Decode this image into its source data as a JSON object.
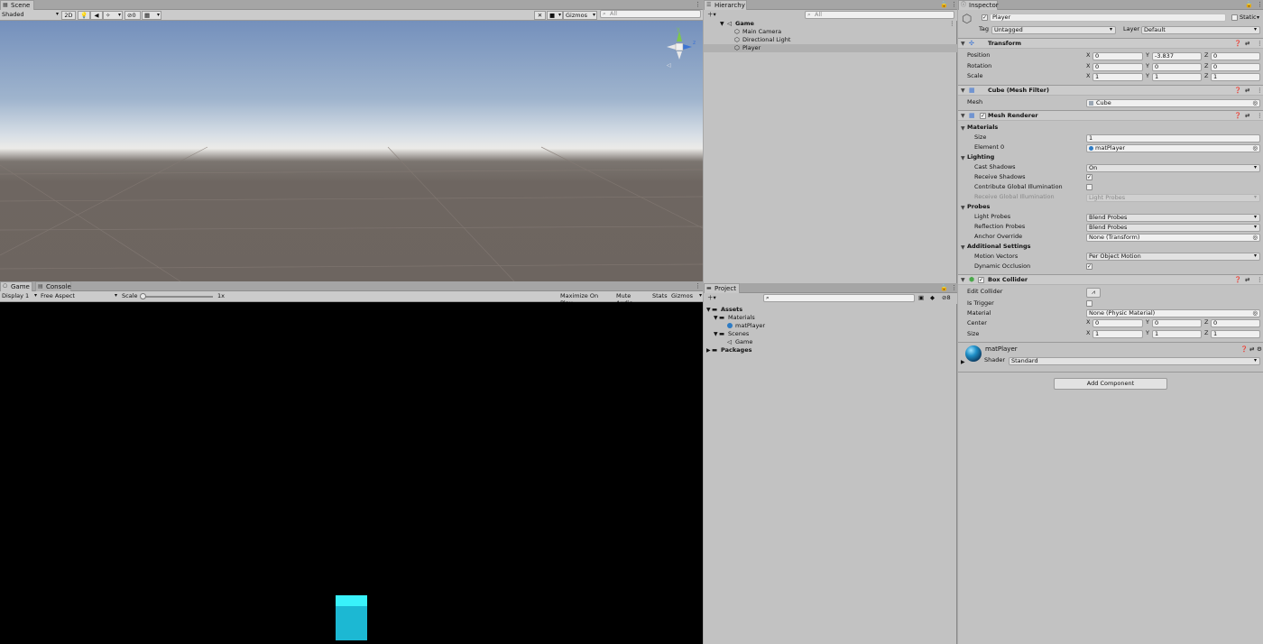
{
  "scene": {
    "tab": "Scene",
    "shading": "Shaded",
    "btn_2d": "2D",
    "hidden_count": "0",
    "gizmos": "Gizmos",
    "search_placeholder": "All"
  },
  "game": {
    "tab_game": "Game",
    "tab_console": "Console",
    "display": "Display 1",
    "aspect": "Free Aspect",
    "scale_label": "Scale",
    "scale_value": "1x",
    "maximize": "Maximize On Play",
    "mute": "Mute Audio",
    "stats": "Stats",
    "gizmos": "Gizmos",
    "cube_color": "#1cb8d3"
  },
  "hierarchy": {
    "tab": "Hierarchy",
    "search_placeholder": "All",
    "scene_name": "Game",
    "items": [
      "Main Camera",
      "Directional Light",
      "Player"
    ]
  },
  "project": {
    "tab": "Project",
    "hidden_count": "8",
    "assets": "Assets",
    "materials": "Materials",
    "matPlayer": "matPlayer",
    "scenes": "Scenes",
    "scene_game": "Game",
    "packages": "Packages"
  },
  "inspector": {
    "tab": "Inspector",
    "object_name": "Player",
    "static_label": "Static",
    "tag_label": "Tag",
    "tag_value": "Untagged",
    "layer_label": "Layer",
    "layer_value": "Default",
    "transform": {
      "title": "Transform",
      "position_label": "Position",
      "rotation_label": "Rotation",
      "scale_label": "Scale",
      "position": [
        "0",
        "-3.837",
        "0"
      ],
      "rotation": [
        "0",
        "0",
        "0"
      ],
      "scale": [
        "1",
        "1",
        "1"
      ]
    },
    "mesh_filter": {
      "title": "Cube (Mesh Filter)",
      "mesh_label": "Mesh",
      "mesh_value": "Cube"
    },
    "mesh_renderer": {
      "title": "Mesh Renderer",
      "materials": "Materials",
      "size_label": "Size",
      "size_value": "1",
      "element0_label": "Element 0",
      "element0_value": "matPlayer",
      "lighting": "Lighting",
      "cast_shadows_label": "Cast Shadows",
      "cast_shadows_value": "On",
      "receive_shadows_label": "Receive Shadows",
      "contribute_gi_label": "Contribute Global Illumination",
      "receive_gi_label": "Receive Global Illumination",
      "receive_gi_value": "Light Probes",
      "probes": "Probes",
      "light_probes_label": "Light Probes",
      "light_probes_value": "Blend Probes",
      "reflection_probes_label": "Reflection Probes",
      "reflection_probes_value": "Blend Probes",
      "anchor_label": "Anchor Override",
      "anchor_value": "None (Transform)",
      "additional": "Additional Settings",
      "motion_vectors_label": "Motion Vectors",
      "motion_vectors_value": "Per Object Motion",
      "dynamic_occlusion_label": "Dynamic Occlusion"
    },
    "box_collider": {
      "title": "Box Collider",
      "edit_label": "Edit Collider",
      "trigger_label": "Is Trigger",
      "material_label": "Material",
      "material_value": "None (Physic Material)",
      "center_label": "Center",
      "size_label": "Size",
      "center": [
        "0",
        "0",
        "0"
      ],
      "size": [
        "1",
        "1",
        "1"
      ]
    },
    "material": {
      "name": "matPlayer",
      "shader_label": "Shader",
      "shader_value": "Standard"
    },
    "add_component": "Add Component",
    "axis": [
      "X",
      "Y",
      "Z"
    ]
  }
}
